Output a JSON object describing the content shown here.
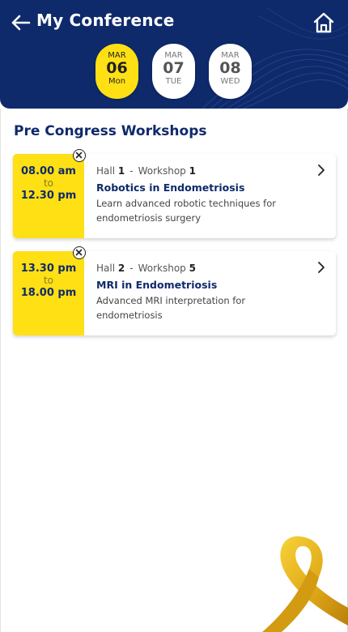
{
  "header": {
    "title": "My Conference",
    "back_icon": "arrow-left-icon",
    "home_icon": "home-icon",
    "background_color": "#0f2a6b"
  },
  "dates": [
    {
      "month": "MAR",
      "day": "06",
      "weekday": "Mon",
      "selected": true
    },
    {
      "month": "MAR",
      "day": "07",
      "weekday": "TUE",
      "selected": false
    },
    {
      "month": "MAR",
      "day": "08",
      "weekday": "WED",
      "selected": false
    }
  ],
  "section": {
    "title": "Pre Congress Workshops"
  },
  "sessions": [
    {
      "start": "08.00 am",
      "to": "to",
      "end": "12.30 pm",
      "hall_label": "Hall",
      "hall": "1",
      "separator": "-",
      "workshop_label": "Workshop",
      "workshop": "1",
      "title": "Robotics in Endometriosis",
      "description": "Learn advanced robotic techniques for endometriosis surgery"
    },
    {
      "start": "13.30 pm",
      "to": "to",
      "end": "18.00 pm",
      "hall_label": "Hall",
      "hall": "2",
      "separator": "-",
      "workshop_label": "Workshop",
      "workshop": "5",
      "title": "MRI in Endometriosis",
      "description": "Advanced MRI interpretation for endometriosis"
    }
  ],
  "accent_color": "#ffe014",
  "decoration": {
    "ribbon_icon": "awareness-ribbon-icon"
  }
}
